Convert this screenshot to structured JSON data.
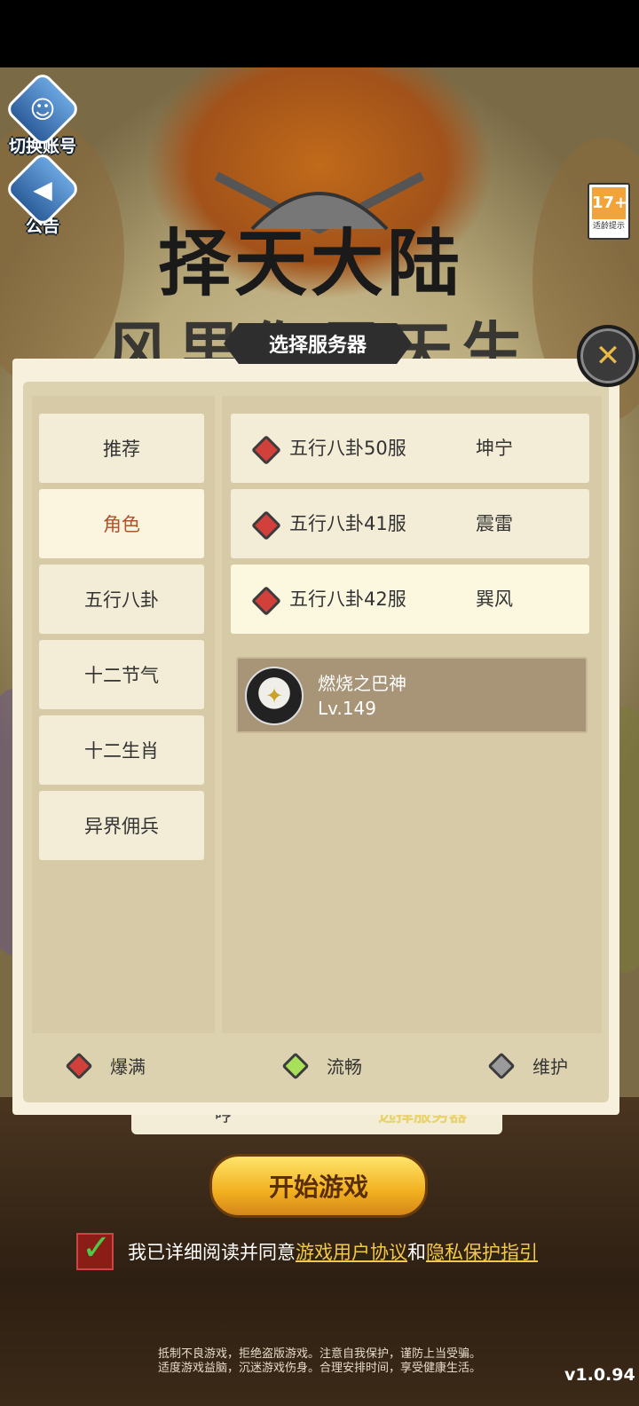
{
  "side": {
    "switch_account": "切换账号",
    "notice": "公告"
  },
  "age_rating": {
    "value": "17+",
    "caption": "适龄提示"
  },
  "logo": {
    "title": "择天大陆",
    "subtitle_partial": "风里你里天生"
  },
  "dialog": {
    "title": "选择服务器",
    "close": "✕",
    "categories": [
      "推荐",
      "角色",
      "五行八卦",
      "十二节气",
      "十二生肖",
      "异界佣兵"
    ],
    "selected_category": "角色",
    "servers": [
      {
        "name": "五行八卦50服",
        "zone": "坤宁",
        "status": "爆满"
      },
      {
        "name": "五行八卦41服",
        "zone": "震雷",
        "status": "爆满"
      },
      {
        "name": "五行八卦42服",
        "zone": "巽风",
        "status": "爆满"
      }
    ],
    "role": {
      "name": "燃烧之巴神",
      "level": "Lv.149"
    },
    "legend": [
      {
        "label": "爆满",
        "color": "#d2403c"
      },
      {
        "label": "流畅",
        "color": "#a8e05a"
      },
      {
        "label": "维护",
        "color": "#9a9a9a"
      }
    ]
  },
  "behind": {
    "server_partial": "哼",
    "select_server": "选择服务器"
  },
  "start_button": "开始游戏",
  "agreement": {
    "prefix": "我已详细阅读并同意",
    "user_agreement": "游戏用户协议",
    "and": "和",
    "privacy": "隐私保护指引"
  },
  "health_notice": {
    "line1": "抵制不良游戏，拒绝盗版游戏。注意自我保护，谨防上当受骗。",
    "line2": "适度游戏益脑，沉迷游戏伤身。合理安排时间，享受健康生活。"
  },
  "version": "v1.0.94"
}
